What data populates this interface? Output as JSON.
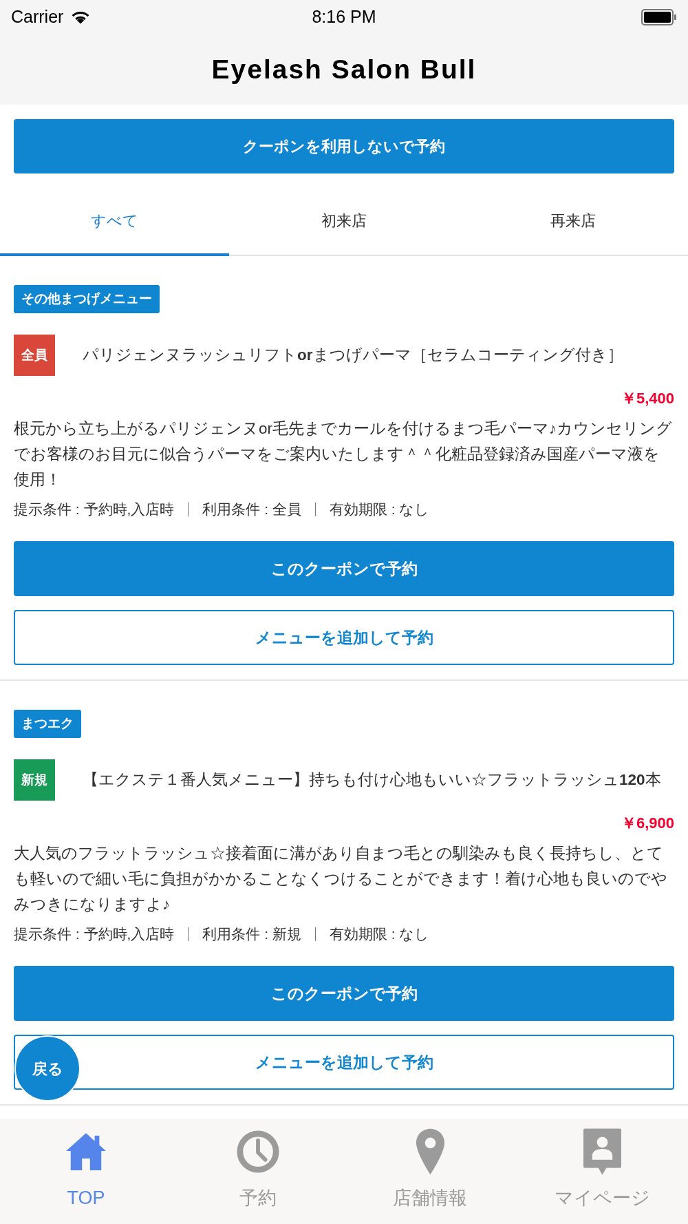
{
  "status_bar": {
    "carrier": "Carrier",
    "time": "8:16 PM"
  },
  "header": {
    "title": "Eyelash Salon Bull"
  },
  "reserve_without_coupon_button": "クーポンを利用しないで予約",
  "tabs": [
    {
      "label": "すべて",
      "selected": true
    },
    {
      "label": "初来店",
      "selected": false
    },
    {
      "label": "再来店",
      "selected": false
    }
  ],
  "coupons": [
    {
      "category": "その他まつげメニュー",
      "target": {
        "label": "全員",
        "color": "#d9473a"
      },
      "title": "パリジェンヌラッシュリフト**or**まつげパーマ［セラムコーティング付き］",
      "price": "￥5,400",
      "description": "根元から立ち上がるパリジェンヌor毛先までカールを付けるまつ毛パーマ♪カウンセリングでお客様のお目元に似合うパーマをご案内いたします＾＾化粧品登録済み国産パーマ液を使用！",
      "conditions": [
        "提示条件 : 予約時,入店時",
        "利用条件 : 全員",
        "有効期限 : なし"
      ],
      "buttons": {
        "reserve": "このクーポンで予約",
        "add_menu": "メニューを追加して予約"
      }
    },
    {
      "category": "まつエク",
      "target": {
        "label": "新規",
        "color": "#189b57"
      },
      "title": "【エクステ１番人気メニュー】持ちも付け心地もいい☆フラットラッシュ**120**本",
      "price": "￥6,900",
      "description": "大人気のフラットラッシュ☆接着面に溝があり自まつ毛との馴染みも良く長持ちし、とても軽いので細い毛に負担がかかることなくつけることができます！着け心地も良いのでやみつきになりますよ♪",
      "conditions": [
        "提示条件 : 予約時,入店時",
        "利用条件 : 新規",
        "有効期限 : なし"
      ],
      "buttons": {
        "reserve": "このクーポンで予約",
        "add_menu": "メニューを追加して予約"
      }
    }
  ],
  "back_button": "戻る",
  "bottom_nav": [
    {
      "label": "TOP",
      "selected": true
    },
    {
      "label": "予約",
      "selected": false
    },
    {
      "label": "店舗情報",
      "selected": false
    },
    {
      "label": "マイページ",
      "selected": false
    }
  ]
}
